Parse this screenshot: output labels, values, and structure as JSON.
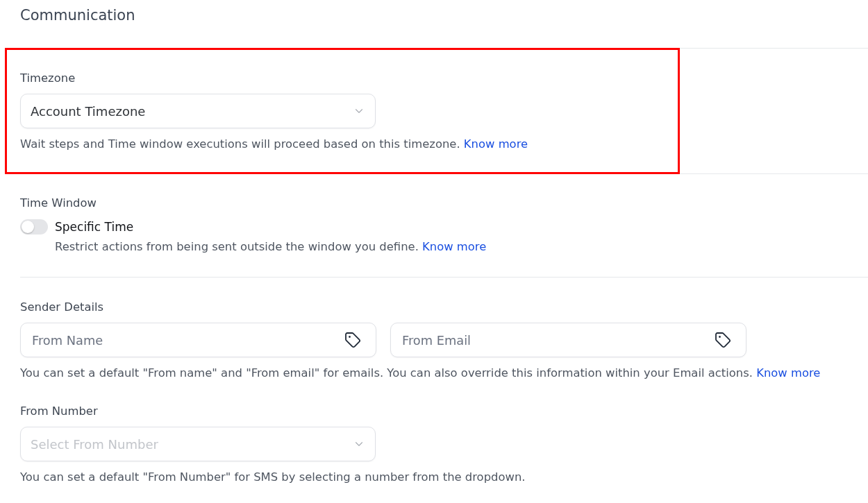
{
  "page": {
    "title": "Communication"
  },
  "timezone": {
    "highlighted": true,
    "label": "Timezone",
    "select": {
      "value": "Account Timezone"
    },
    "help": {
      "text": "Wait steps and Time window executions will proceed based on this timezone.",
      "link": "Know more"
    }
  },
  "time_window": {
    "label": "Time Window",
    "toggle": {
      "label": "Specific Time",
      "on": false
    },
    "help": {
      "text": "Restrict actions from being sent outside the window you define.",
      "link": "Know more"
    }
  },
  "sender_details": {
    "label": "Sender Details",
    "fields": [
      {
        "placeholder": "From Name"
      },
      {
        "placeholder": "From Email"
      }
    ],
    "help": {
      "text": "You can set a default \"From name\" and \"From email\" for emails. You can also override this information within your Email actions.",
      "link": "Know more"
    }
  },
  "from_number": {
    "label": "From Number",
    "select": {
      "placeholder": "Select From Number"
    },
    "help": {
      "text": "You can set a default \"From Number\" for SMS by selecting a number from the dropdown."
    }
  }
}
